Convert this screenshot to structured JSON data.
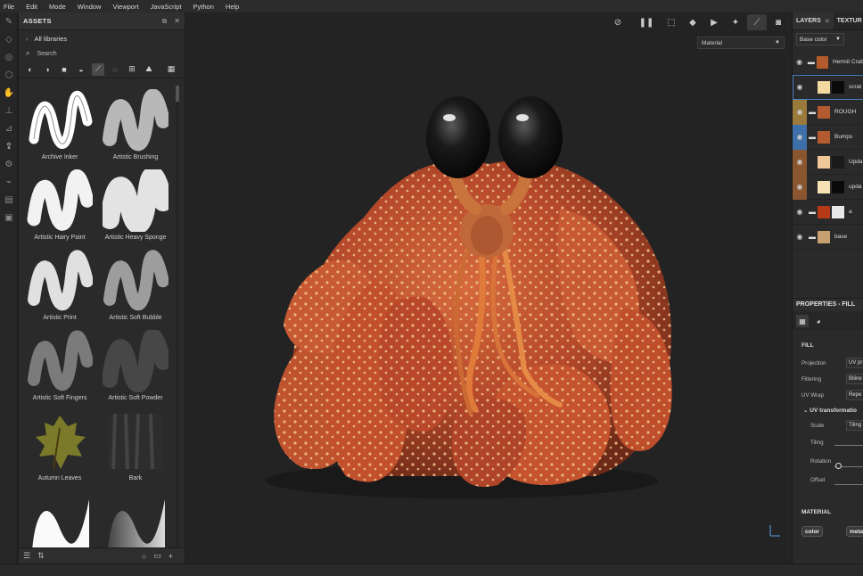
{
  "menu": [
    "File",
    "Edit",
    "Mode",
    "Window",
    "Viewport",
    "JavaScript",
    "Python",
    "Help"
  ],
  "assets": {
    "title": "ASSETS",
    "library": "All libraries",
    "search_placeholder": "Search",
    "items": [
      {
        "label": "Archive Inker"
      },
      {
        "label": "Artistic Brushing"
      },
      {
        "label": "Artistic Hairy Paint"
      },
      {
        "label": "Artistic Heavy Sponge"
      },
      {
        "label": "Artistic Print"
      },
      {
        "label": "Artistic Soft Bubble"
      },
      {
        "label": "Artistic Soft Fingers"
      },
      {
        "label": "Artistic Soft Powder"
      },
      {
        "label": "Autumn Leaves"
      },
      {
        "label": "Bark"
      },
      {
        "label": ""
      },
      {
        "label": ""
      }
    ]
  },
  "viewport": {
    "material_select": "Material"
  },
  "right": {
    "tabs": [
      "LAYERS",
      "TEXTUR"
    ],
    "channel": "Base color",
    "layers": [
      {
        "name": "Hermit Crab",
        "eye": "plain",
        "folder": true,
        "swatch": "#b55a2c",
        "swatch2": ""
      },
      {
        "name": "scrat",
        "eye": "plain",
        "folder": false,
        "swatch": "#f3d9a0",
        "swatch2": "#0a0a0a"
      },
      {
        "name": "ROUGH",
        "eye": "gold",
        "folder": true,
        "swatch": "#b45a30",
        "swatch2": ""
      },
      {
        "name": "Bumps",
        "eye": "blue",
        "folder": true,
        "swatch": "#b45a30",
        "swatch2": ""
      },
      {
        "name": "Upda",
        "eye": "rust",
        "folder": false,
        "swatch": "#f0c898",
        "swatch2": "#1a1a1a"
      },
      {
        "name": "upda",
        "eye": "rust",
        "folder": false,
        "swatch": "#f6e1b4",
        "swatch2": "#0a0a0a"
      },
      {
        "name": "a",
        "eye": "plain",
        "folder": true,
        "swatch": "#b63a18",
        "swatch2": "#e8e8e8"
      },
      {
        "name": "base",
        "eye": "plain",
        "folder": true,
        "swatch": "#c8a070",
        "swatch2": ""
      }
    ],
    "properties": {
      "title": "PROPERTIES - FILL",
      "fill_title": "FILL",
      "projection_label": "Projection",
      "projection_value": "UV pr",
      "filtering_label": "Filtering",
      "filtering_value": "Biline",
      "uvwrap_label": "UV Wrap",
      "uvwrap_value": "Repe",
      "uvtrans_title": "UV transformatio",
      "scale_label": "Scale",
      "scale_value": "Tiling",
      "tiling_label": "Tiling",
      "rotation_label": "Rotation",
      "offset_label": "Offset",
      "material_title": "MATERIAL",
      "chip_color": "color",
      "chip_meta": "meta"
    }
  }
}
